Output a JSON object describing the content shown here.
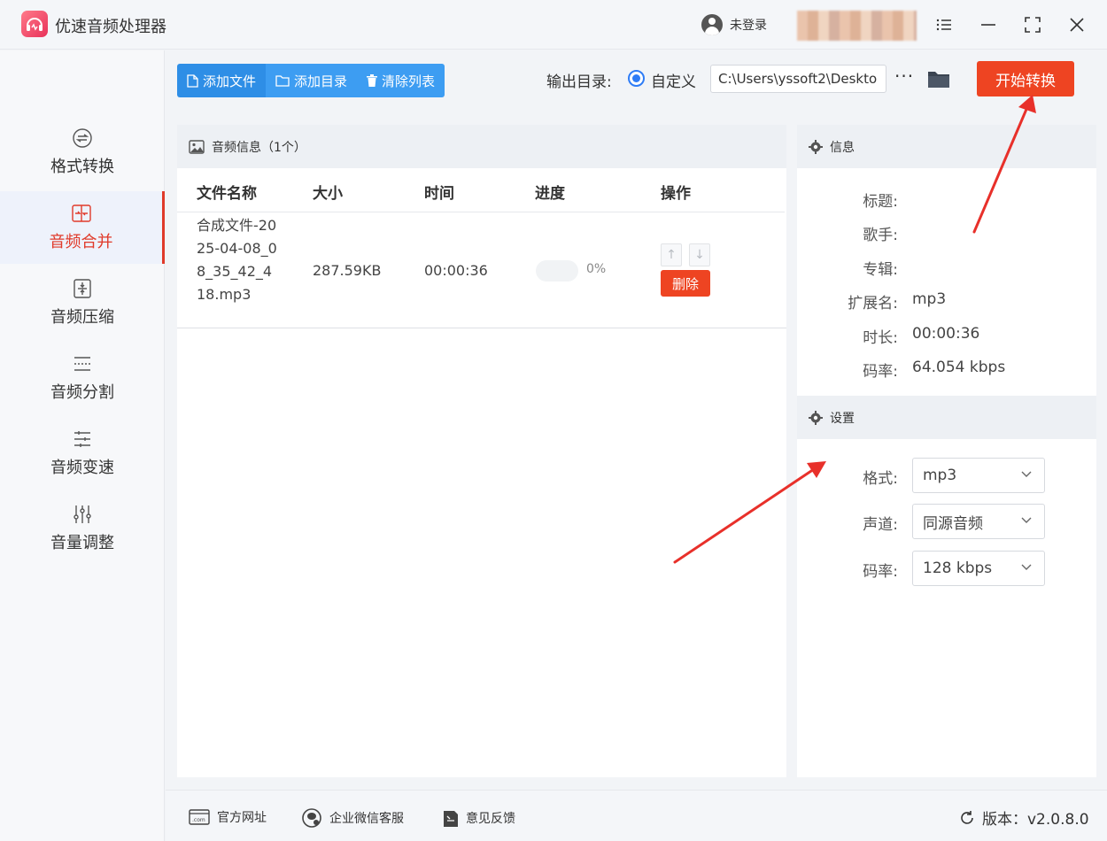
{
  "app": {
    "title": "优速音频处理器",
    "login_label": "未登录"
  },
  "colors": {
    "accent": "#3d9df2",
    "danger": "#ee4422",
    "active": "#e03a2a"
  },
  "sidebar": {
    "items": [
      {
        "label": "格式转换",
        "icon": "format-convert-icon"
      },
      {
        "label": "音频合并",
        "icon": "audio-merge-icon",
        "active": true
      },
      {
        "label": "音频压缩",
        "icon": "audio-compress-icon"
      },
      {
        "label": "音频分割",
        "icon": "audio-split-icon"
      },
      {
        "label": "音频变速",
        "icon": "audio-speed-icon"
      },
      {
        "label": "音量调整",
        "icon": "volume-adjust-icon"
      }
    ]
  },
  "toolbar": {
    "add_file": "添加文件",
    "add_dir": "添加目录",
    "clear_list": "清除列表",
    "output_label": "输出目录:",
    "radio_label": "自定义",
    "path": "C:\\Users\\yssoft2\\Deskto",
    "dots": "···",
    "start": "开始转换"
  },
  "file_panel": {
    "title": "音频信息（1个）",
    "columns": {
      "name": "文件名称",
      "size": "大小",
      "time": "时间",
      "progress": "进度",
      "action": "操作"
    },
    "rows": [
      {
        "name": "合成文件-2025-04-08_08_35_42_418.mp3",
        "size": "287.59KB",
        "time": "00:00:36",
        "progress": 0,
        "progress_text": "0%",
        "delete_label": "删除"
      }
    ]
  },
  "info_panel": {
    "title": "信息",
    "title_label": "标题:",
    "title_value": "",
    "artist_label": "歌手:",
    "artist_value": "",
    "album_label": "专辑:",
    "album_value": "",
    "ext_label": "扩展名:",
    "ext_value": "mp3",
    "duration_label": "时长:",
    "duration_value": "00:00:36",
    "bitrate_label": "码率:",
    "bitrate_value": "64.054 kbps"
  },
  "settings_panel": {
    "title": "设置",
    "format_label": "格式:",
    "format_value": "mp3",
    "channel_label": "声道:",
    "channel_value": "同源音频",
    "bitrate_label": "码率:",
    "bitrate_value": "128 kbps"
  },
  "footer": {
    "website": "官方网址",
    "wechat": "企业微信客服",
    "feedback": "意见反馈",
    "version": "版本：v2.0.8.0"
  }
}
